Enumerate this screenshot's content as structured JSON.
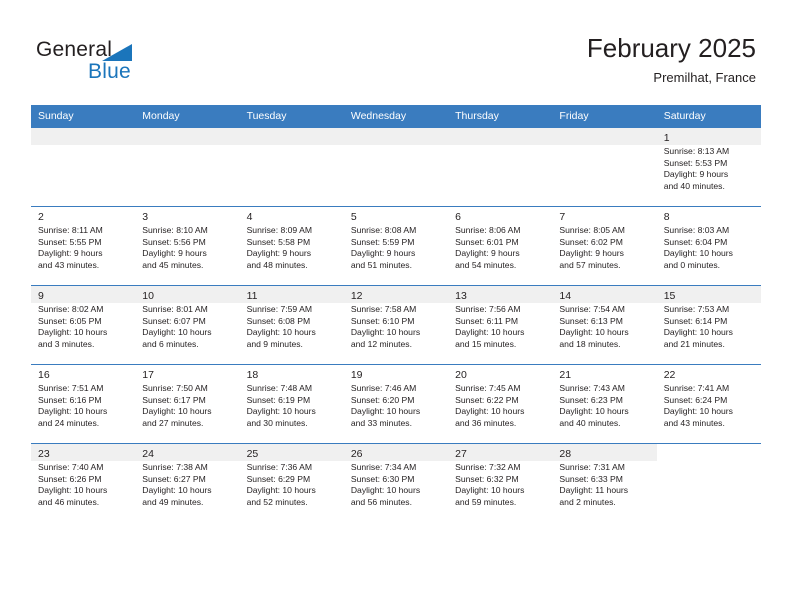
{
  "brand": {
    "word_general": "General",
    "word_blue": "Blue",
    "triangle_color": "#1b75bb"
  },
  "header": {
    "title": "February 2025",
    "subtitle": "Premilhat, France",
    "accent_color": "#3a7cbf",
    "shade_color": "#f0f0f0"
  },
  "calendar": {
    "weekday_headers": [
      "Sunday",
      "Monday",
      "Tuesday",
      "Wednesday",
      "Thursday",
      "Friday",
      "Saturday"
    ],
    "weeks": [
      [
        {
          "day": "",
          "info": "",
          "empty": true
        },
        {
          "day": "",
          "info": "",
          "empty": true
        },
        {
          "day": "",
          "info": "",
          "empty": true
        },
        {
          "day": "",
          "info": "",
          "empty": true
        },
        {
          "day": "",
          "info": "",
          "empty": true
        },
        {
          "day": "",
          "info": "",
          "empty": true
        },
        {
          "day": "1",
          "info": "Sunrise: 8:13 AM\nSunset: 5:53 PM\nDaylight: 9 hours\nand 40 minutes."
        }
      ],
      [
        {
          "day": "2",
          "info": "Sunrise: 8:11 AM\nSunset: 5:55 PM\nDaylight: 9 hours\nand 43 minutes."
        },
        {
          "day": "3",
          "info": "Sunrise: 8:10 AM\nSunset: 5:56 PM\nDaylight: 9 hours\nand 45 minutes."
        },
        {
          "day": "4",
          "info": "Sunrise: 8:09 AM\nSunset: 5:58 PM\nDaylight: 9 hours\nand 48 minutes."
        },
        {
          "day": "5",
          "info": "Sunrise: 8:08 AM\nSunset: 5:59 PM\nDaylight: 9 hours\nand 51 minutes."
        },
        {
          "day": "6",
          "info": "Sunrise: 8:06 AM\nSunset: 6:01 PM\nDaylight: 9 hours\nand 54 minutes."
        },
        {
          "day": "7",
          "info": "Sunrise: 8:05 AM\nSunset: 6:02 PM\nDaylight: 9 hours\nand 57 minutes."
        },
        {
          "day": "8",
          "info": "Sunrise: 8:03 AM\nSunset: 6:04 PM\nDaylight: 10 hours\nand 0 minutes."
        }
      ],
      [
        {
          "day": "9",
          "info": "Sunrise: 8:02 AM\nSunset: 6:05 PM\nDaylight: 10 hours\nand 3 minutes."
        },
        {
          "day": "10",
          "info": "Sunrise: 8:01 AM\nSunset: 6:07 PM\nDaylight: 10 hours\nand 6 minutes."
        },
        {
          "day": "11",
          "info": "Sunrise: 7:59 AM\nSunset: 6:08 PM\nDaylight: 10 hours\nand 9 minutes."
        },
        {
          "day": "12",
          "info": "Sunrise: 7:58 AM\nSunset: 6:10 PM\nDaylight: 10 hours\nand 12 minutes."
        },
        {
          "day": "13",
          "info": "Sunrise: 7:56 AM\nSunset: 6:11 PM\nDaylight: 10 hours\nand 15 minutes."
        },
        {
          "day": "14",
          "info": "Sunrise: 7:54 AM\nSunset: 6:13 PM\nDaylight: 10 hours\nand 18 minutes."
        },
        {
          "day": "15",
          "info": "Sunrise: 7:53 AM\nSunset: 6:14 PM\nDaylight: 10 hours\nand 21 minutes."
        }
      ],
      [
        {
          "day": "16",
          "info": "Sunrise: 7:51 AM\nSunset: 6:16 PM\nDaylight: 10 hours\nand 24 minutes."
        },
        {
          "day": "17",
          "info": "Sunrise: 7:50 AM\nSunset: 6:17 PM\nDaylight: 10 hours\nand 27 minutes."
        },
        {
          "day": "18",
          "info": "Sunrise: 7:48 AM\nSunset: 6:19 PM\nDaylight: 10 hours\nand 30 minutes."
        },
        {
          "day": "19",
          "info": "Sunrise: 7:46 AM\nSunset: 6:20 PM\nDaylight: 10 hours\nand 33 minutes."
        },
        {
          "day": "20",
          "info": "Sunrise: 7:45 AM\nSunset: 6:22 PM\nDaylight: 10 hours\nand 36 minutes."
        },
        {
          "day": "21",
          "info": "Sunrise: 7:43 AM\nSunset: 6:23 PM\nDaylight: 10 hours\nand 40 minutes."
        },
        {
          "day": "22",
          "info": "Sunrise: 7:41 AM\nSunset: 6:24 PM\nDaylight: 10 hours\nand 43 minutes."
        }
      ],
      [
        {
          "day": "23",
          "info": "Sunrise: 7:40 AM\nSunset: 6:26 PM\nDaylight: 10 hours\nand 46 minutes."
        },
        {
          "day": "24",
          "info": "Sunrise: 7:38 AM\nSunset: 6:27 PM\nDaylight: 10 hours\nand 49 minutes."
        },
        {
          "day": "25",
          "info": "Sunrise: 7:36 AM\nSunset: 6:29 PM\nDaylight: 10 hours\nand 52 minutes."
        },
        {
          "day": "26",
          "info": "Sunrise: 7:34 AM\nSunset: 6:30 PM\nDaylight: 10 hours\nand 56 minutes."
        },
        {
          "day": "27",
          "info": "Sunrise: 7:32 AM\nSunset: 6:32 PM\nDaylight: 10 hours\nand 59 minutes."
        },
        {
          "day": "28",
          "info": "Sunrise: 7:31 AM\nSunset: 6:33 PM\nDaylight: 11 hours\nand 2 minutes."
        },
        {
          "day": "",
          "info": "",
          "empty": true,
          "blank": true
        }
      ]
    ]
  }
}
